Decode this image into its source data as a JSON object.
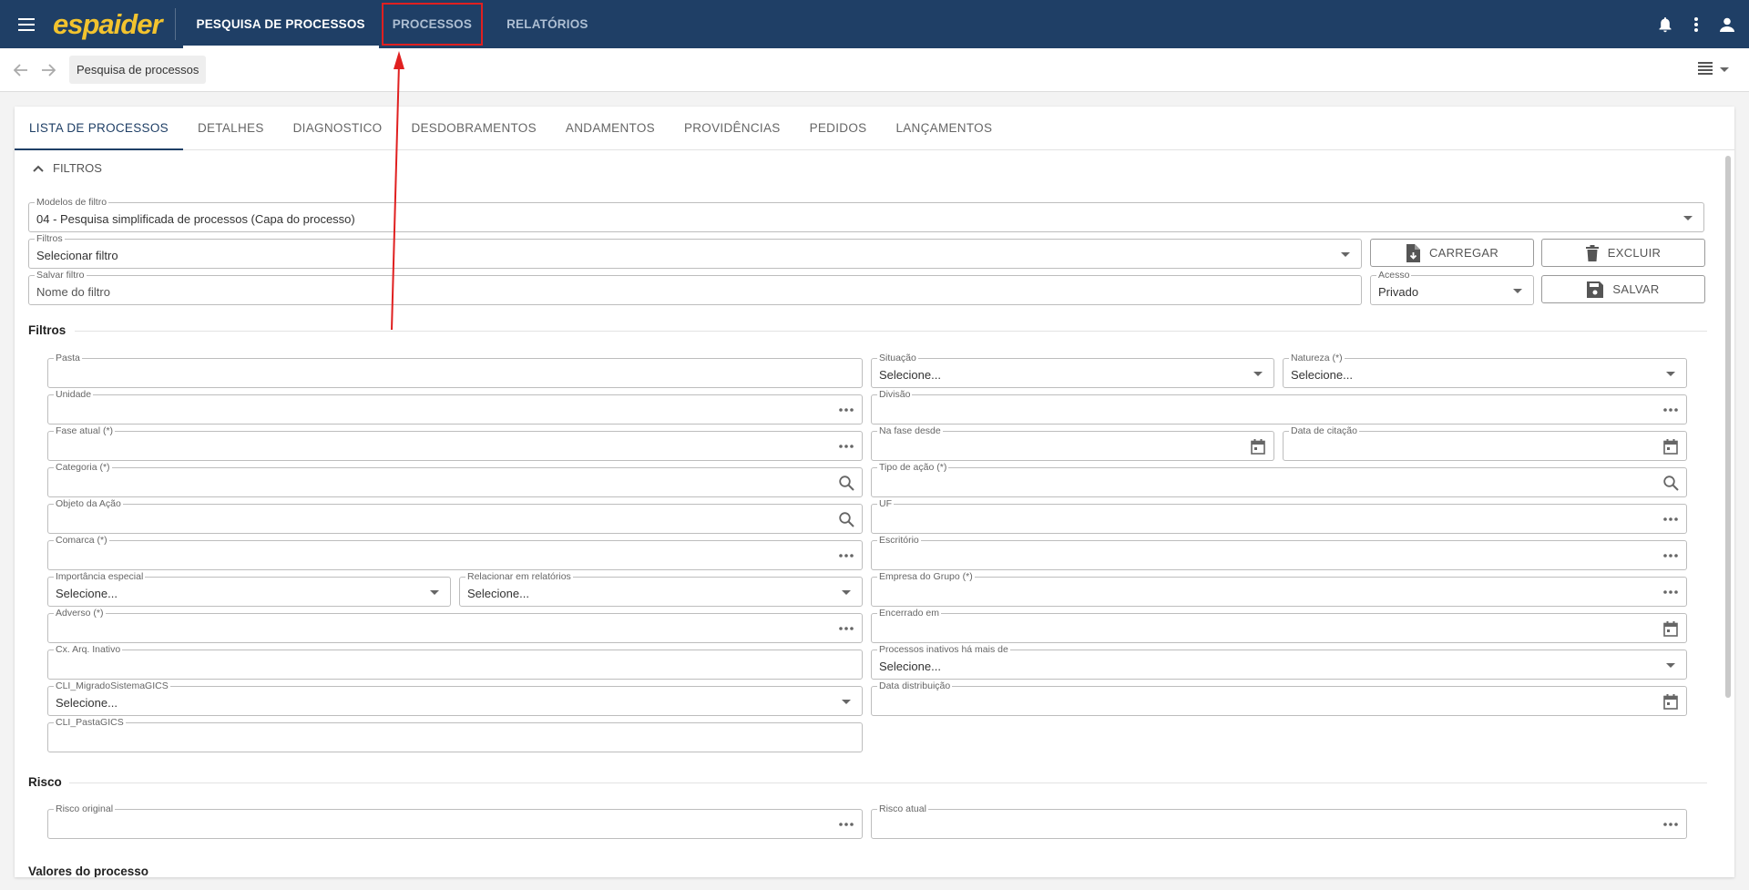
{
  "app": {
    "logo": "espaider",
    "nav": [
      "PESQUISA DE PROCESSOS",
      "PROCESSOS",
      "RELATÓRIOS"
    ]
  },
  "breadcrumb": "Pesquisa de processos",
  "tabs": [
    "LISTA DE PROCESSOS",
    "DETALHES",
    "DIAGNOSTICO",
    "DESDOBRAMENTOS",
    "ANDAMENTOS",
    "PROVIDÊNCIAS",
    "PEDIDOS",
    "LANÇAMENTOS"
  ],
  "filters_toggle": "FILTROS",
  "modelos": {
    "label": "Modelos de filtro",
    "value": "04 - Pesquisa simplificada de processos (Capa do processo)"
  },
  "filtros_select": {
    "label": "Filtros",
    "value": "Selecionar filtro"
  },
  "salvar_filtro": {
    "label": "Salvar filtro",
    "placeholder": "Nome do filtro"
  },
  "acesso": {
    "label": "Acesso",
    "value": "Privado"
  },
  "buttons": {
    "carregar": "CARREGAR",
    "excluir": "EXCLUIR",
    "salvar": "SALVAR"
  },
  "sections": {
    "filtros": "Filtros",
    "risco": "Risco",
    "valores": "Valores do processo"
  },
  "fields": {
    "pasta": "Pasta",
    "situacao": "Situação",
    "natureza": "Natureza (*)",
    "unidade": "Unidade",
    "divisao": "Divisão",
    "fase_atual": "Fase atual (*)",
    "na_fase_desde": "Na fase desde",
    "data_citacao": "Data de citação",
    "categoria": "Categoria (*)",
    "tipo_acao": "Tipo de ação (*)",
    "objeto_acao": "Objeto da Ação",
    "uf": "UF",
    "comarca": "Comarca (*)",
    "escritorio": "Escritório",
    "importancia": "Importância especial",
    "relacionar": "Relacionar em relatórios",
    "empresa_grupo": "Empresa do Grupo (*)",
    "adverso": "Adverso (*)",
    "encerrado_em": "Encerrado em",
    "cx_arq": "Cx. Arq. Inativo",
    "inativos": "Processos inativos há mais de",
    "cli_migrado": "CLI_MigradoSistemaGICS",
    "data_distribuicao": "Data distribuição",
    "cli_pasta": "CLI_PastaGICS",
    "risco_original": "Risco original",
    "risco_atual": "Risco atual"
  },
  "select_placeholder": "Selecione..."
}
